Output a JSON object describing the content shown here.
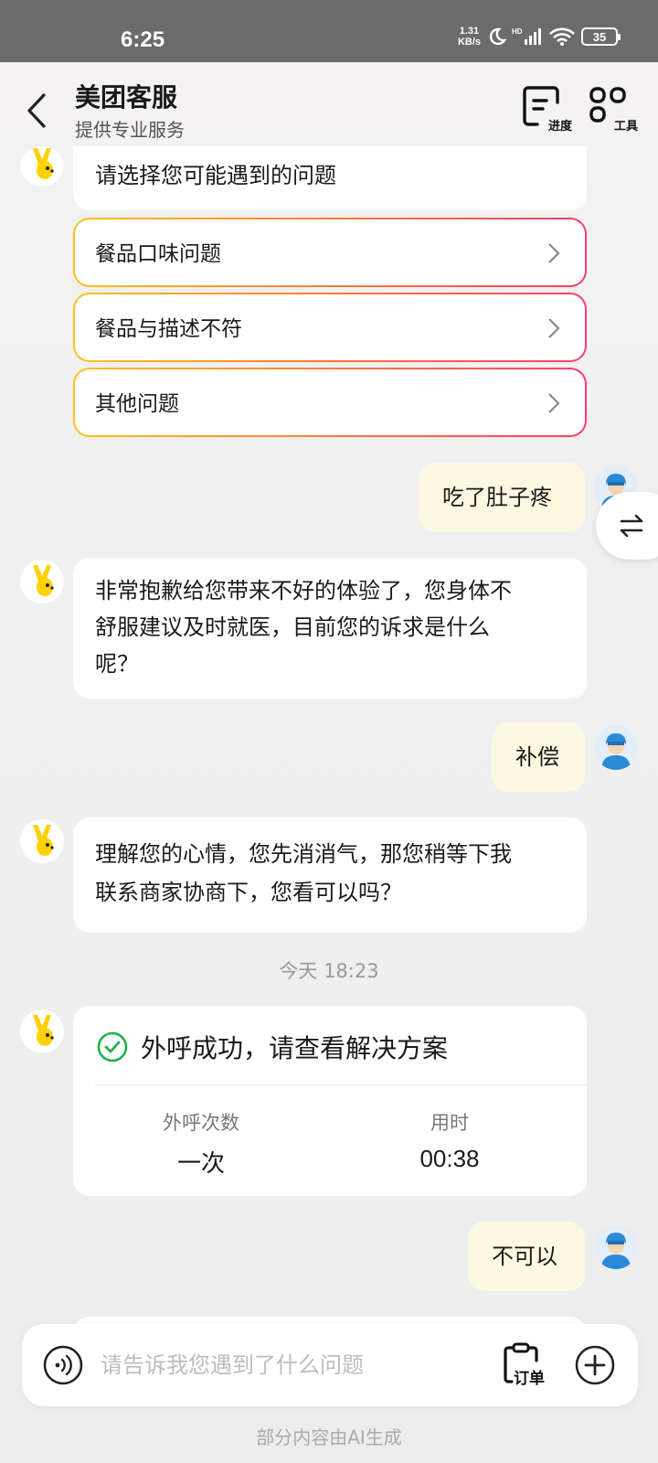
{
  "status_bar": {
    "time": "6:25",
    "net_speed_value": "1.31",
    "net_speed_unit": "KB/s",
    "battery": "35"
  },
  "header": {
    "title": "美团客服",
    "subtitle": "提供专业服务",
    "progress_label": "进度",
    "tools_label": "工具"
  },
  "messages": {
    "prompt": "请选择您可能遇到的问题",
    "options": [
      "餐品口味问题",
      "餐品与描述不符",
      "其他问题"
    ],
    "user1": "吃了肚子疼",
    "bot1_line1": "非常抱歉给您带来不好的体验了，您身体不",
    "bot1_line2": "舒服建议及时就医，目前您的诉求是什么",
    "bot1_line3": "呢？",
    "user2": "补偿",
    "bot2_line1": "理解您的心情，您先消消气，那您稍等下我",
    "bot2_line2": "联系商家协商下，您看可以吗？",
    "time_separator": "今天 18:23",
    "call_card": {
      "title": "外呼成功，请查看解决方案",
      "count_label": "外呼次数",
      "count_value": "一次",
      "duration_label": "用时",
      "duration_value": "00:38"
    },
    "user3": "不可以"
  },
  "input": {
    "placeholder": "请告诉我您遇到了什么问题",
    "order_label": "订单"
  },
  "footer": "部分内容由AI生成",
  "colors": {
    "status_bar": "#6b6b6b",
    "user_bubble": "#fdf8e1",
    "option_gradient_start": "#ffc21a",
    "option_gradient_end": "#ff3b6b",
    "success_green": "#22b14c",
    "bot_avatar_yellow": "#ffd100",
    "user_avatar_blue": "#2a8ad8"
  },
  "icons": [
    "back-arrow-icon",
    "progress-icon",
    "tools-icon",
    "swap-icon",
    "check-circle-icon",
    "voice-icon",
    "order-icon",
    "plus-icon"
  ]
}
